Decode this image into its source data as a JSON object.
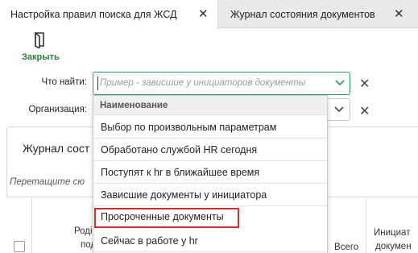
{
  "tabs": [
    {
      "label": "Настройка правил поиска для ЖСД"
    },
    {
      "label": "Журнал состояния документов"
    }
  ],
  "toolbar": {
    "close_label": "Закрыть"
  },
  "form": {
    "find_label": "Что найти:",
    "find_placeholder": "Пример - зависшие у инициаторов документы",
    "org_label": "Организация:"
  },
  "panel": {
    "title": "Журнал сост",
    "drag_hint": "Перетащите сю",
    "columns": [
      "Родi",
      "подр",
      "Всего",
      "Инициат",
      "докумен"
    ]
  },
  "dropdown": {
    "header": "Наименование",
    "items": [
      {
        "label": "Выбор по произвольным параметрам"
      },
      {
        "label": "Обработано службой HR сегодня"
      },
      {
        "label": "Поступят к hr в ближайшее время"
      },
      {
        "label": "Зависшие документы у инициатора"
      },
      {
        "label": "Просроченные документы"
      },
      {
        "label": "Сейчас в работе у hr"
      }
    ]
  },
  "colors": {
    "accent": "#2e9e5a",
    "highlight": "#d32f2f",
    "close_label": "#2e7d32"
  }
}
